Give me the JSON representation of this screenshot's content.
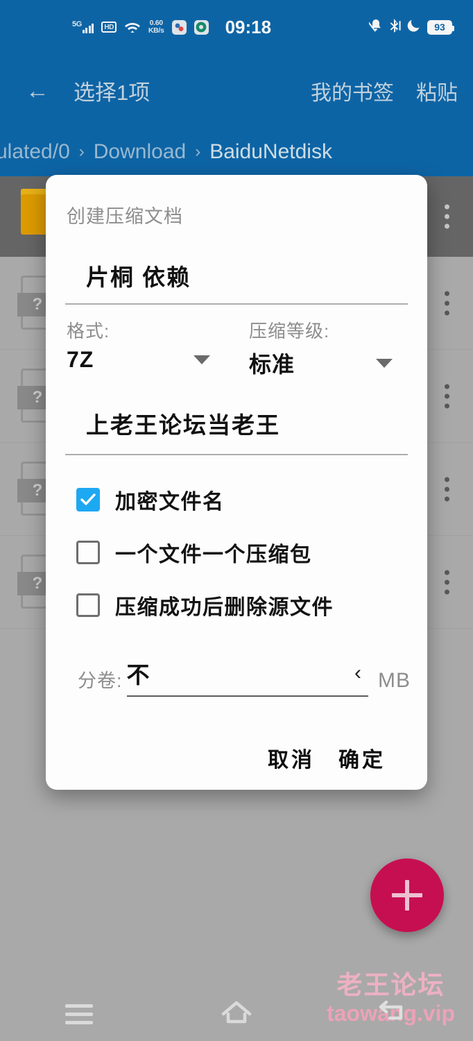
{
  "status_bar": {
    "network_label": "5G",
    "hd_label": "HD",
    "data_rate": "0.60",
    "data_rate_unit": "KB/s",
    "clock": "09:18",
    "battery": "93",
    "icons": [
      "signal-bars-icon",
      "hd-icon",
      "wifi-icon",
      "data-rate-icon",
      "app-icon-1",
      "chrome-icon",
      "mute-icon",
      "bluetooth-icon",
      "do-not-disturb-icon",
      "battery-icon"
    ]
  },
  "toolbar": {
    "back_icon": "←",
    "title": "选择1项",
    "action_bookmarks": "我的书签",
    "action_paste": "粘贴"
  },
  "breadcrumb": {
    "separator": "›",
    "items": [
      "ulated/0",
      "Download",
      "BaiduNetdisk"
    ]
  },
  "file_list": {
    "rows": [
      {
        "icon": "folder-icon",
        "selected": true
      },
      {
        "icon": "unknown-file-icon",
        "selected": false
      },
      {
        "icon": "unknown-file-icon",
        "selected": false
      },
      {
        "icon": "unknown-file-icon",
        "selected": false
      },
      {
        "icon": "unknown-file-icon",
        "selected": false
      }
    ],
    "unknown_glyph": "?"
  },
  "fab": {
    "label": "+",
    "color": "#cf1055"
  },
  "watermark": {
    "cn": "老王论坛",
    "en": "taowang.vip"
  },
  "navbar": {
    "recents_icon": "menu-icon",
    "home_icon": "home-icon",
    "back_icon": "back-arrow-icon"
  },
  "dialog": {
    "title": "创建压缩文档",
    "archive_name": "片桐 依赖",
    "format": {
      "label": "格式:",
      "value": "7Z"
    },
    "level": {
      "label": "压缩等级:",
      "value": "标准"
    },
    "password": "上老王论坛当老王",
    "checkboxes": [
      {
        "label": "加密文件名",
        "checked": true
      },
      {
        "label": "一个文件一个压缩包",
        "checked": false
      },
      {
        "label": "压缩成功后删除源文件",
        "checked": false
      }
    ],
    "split": {
      "label": "分卷:",
      "value": "不",
      "chevron": "‹",
      "unit": "MB"
    },
    "buttons": {
      "cancel": "取消",
      "confirm": "确定"
    }
  },
  "colors": {
    "toolbar_blue": "#0E69AC",
    "checkbox_blue": "#1DA8F2",
    "fab_pink": "#cf1055",
    "folder_orange": "#e6a200"
  }
}
